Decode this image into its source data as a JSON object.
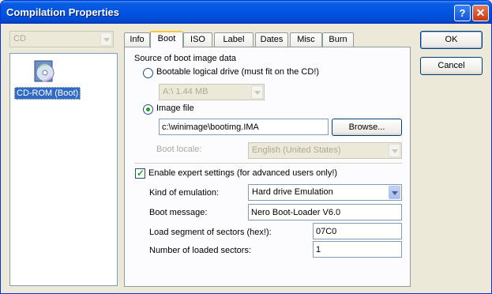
{
  "window": {
    "title": "Compilation Properties",
    "help_label": "?",
    "close_label": "✕"
  },
  "left": {
    "type_combo": "CD",
    "item_label": "CD-ROM (Boot)"
  },
  "tabs": [
    {
      "label": "Info"
    },
    {
      "label": "Boot"
    },
    {
      "label": "ISO"
    },
    {
      "label": "Label"
    },
    {
      "label": "Dates"
    },
    {
      "label": "Misc"
    },
    {
      "label": "Burn"
    }
  ],
  "active_tab": "Boot",
  "boot": {
    "group_title": "Source of boot image data",
    "radio_drive_label": "Bootable logical drive (must fit on the CD!)",
    "drive_combo": "A:\\  1.44 MB",
    "radio_image_label": "Image file",
    "image_path": "c:\\winimage\\bootimg.IMA",
    "browse_label": "Browse...",
    "locale_label": "Boot locale:",
    "locale_value": "English (United States)",
    "expert_label": "Enable expert settings (for advanced users only!)",
    "emulation_label": "Kind of emulation:",
    "emulation_value": "Hard drive Emulation",
    "message_label": "Boot message:",
    "message_value": "Nero Boot-Loader V6.0",
    "segment_label": "Load segment of sectors (hex!):",
    "segment_value": "07C0",
    "sectors_label": "Number of loaded sectors:",
    "sectors_value": "1"
  },
  "buttons": {
    "ok": "OK",
    "cancel": "Cancel"
  }
}
